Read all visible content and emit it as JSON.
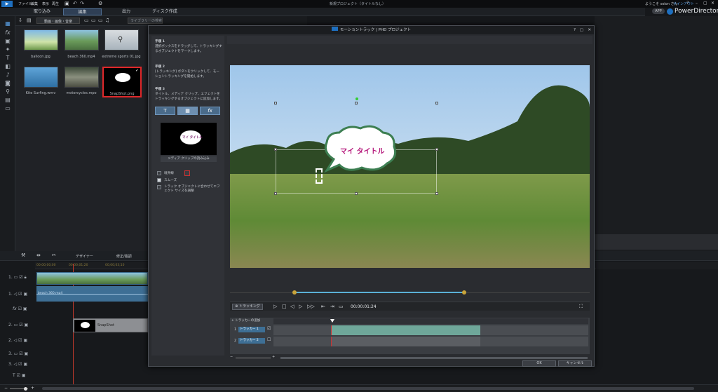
{
  "titlebar": {
    "menus": [
      "ファイル",
      "編集",
      "表示",
      "再生"
    ],
    "project_title": "新規プロジェクト（タイトルなし）",
    "greeting": "ようこそ soion さん",
    "signup": "サインアウト",
    "app_badge": "APP",
    "app_name": "PowerDirector"
  },
  "modes": [
    "取り込み",
    "編集",
    "出力",
    "ディスク作成"
  ],
  "library": {
    "filter_label": "動画・画像・音楽",
    "search_placeholder": "ライブラリーの検索",
    "items": [
      {
        "label": "balloon.jpg"
      },
      {
        "label": "beach 360.mp4"
      },
      {
        "label": "extreme sports 01.jpg"
      },
      {
        "label": "Kite Surfing.wmv"
      },
      {
        "label": "motorcycles.mpo"
      },
      {
        "label": "SnapShot.png"
      }
    ]
  },
  "timeline": {
    "designer_label": "デザイナー",
    "fix_label": "修正/強調",
    "time_marks": [
      "00;00;00;00",
      "00;00;01;20",
      "00;00;03;10"
    ],
    "tracks": [
      "1.",
      "1.",
      "fx",
      "2.",
      "2.",
      "3.",
      "3.",
      "T"
    ],
    "clip_audio_label": "beach 360.mp4",
    "title_clip_label": "SnapShot"
  },
  "dialog": {
    "title": "モーショントラック | PHD プロジェクト",
    "help": "?",
    "restore": "▢",
    "close": "✕",
    "step1_title": "手順 1",
    "step1_text": "選択ボックスをドラッグして、トラッキングするオブジェクトをマークします。",
    "step2_title": "手順 2",
    "step2_text": "[トラッキング] ボタンをクリックして、モーショントラッキングを開始します。",
    "step3_title": "手順 3",
    "step3_text": "タイトル、メディア クリップ、エフェクトをトラッキングするオブジェクトに追加します。",
    "tool_title": "T",
    "tool_media": "▦",
    "tool_fx": "fx",
    "preview_text": "マイ タイトル",
    "import_media": "メディア クリップの読み込み",
    "cb_boundary": "境界線",
    "cb_smooth": "スムーズ",
    "cb_resize": "トラック オブジェクトに合わせてエフェクト サイズを調整",
    "video_title_text": "マイ タイトル",
    "track_button": "トラッキング",
    "timecode": "00:00:01:24",
    "add_tracker": "トラッカーの追加",
    "tracker1": "トラッカー 1",
    "tracker2": "トラッカー 2",
    "ok": "OK",
    "cancel": "キャンセル"
  },
  "colors": {
    "accent": "#4d6b8f",
    "track_green": "#6fa79a",
    "select_red": "#e0282a"
  }
}
